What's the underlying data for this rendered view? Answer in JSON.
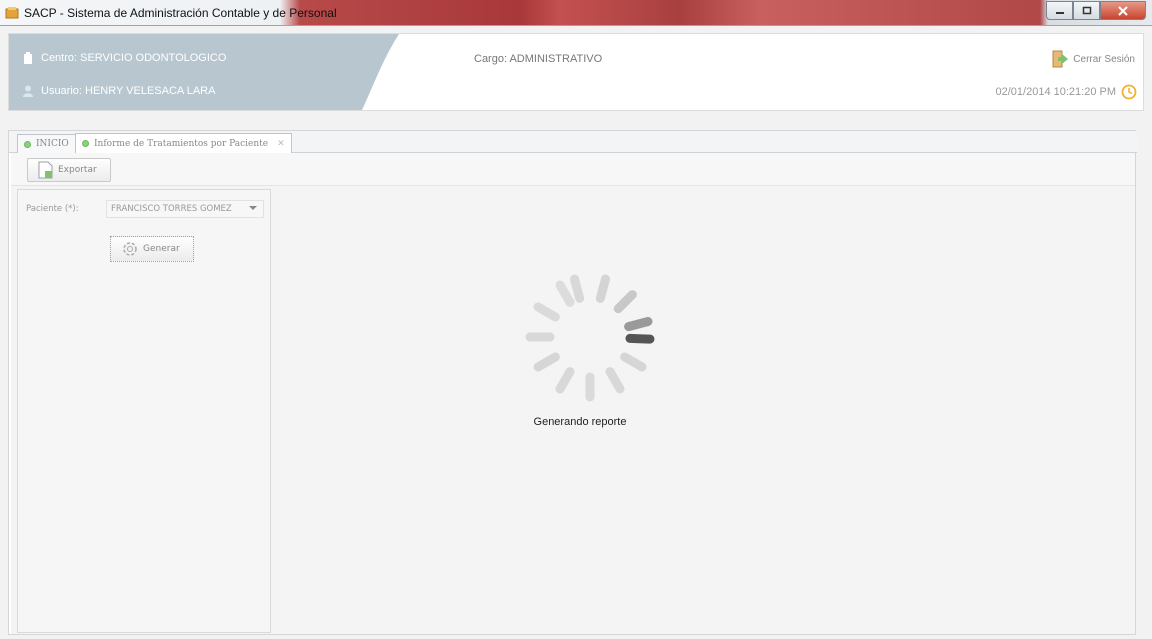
{
  "window": {
    "title": "SACP - Sistema de Administración Contable y de Personal",
    "icon": "app-icon",
    "buttons": [
      "minimize",
      "maximize",
      "close"
    ]
  },
  "header": {
    "centro": "Centro: SERVICIO ODONTOLOGICO",
    "usuario": "Usuario: HENRY VELESACA LARA",
    "cargo": "Cargo:  ADMINISTRATIVO",
    "logout_label": "Cerrar Sesión",
    "datetime": "02/01/2014 10:21:20 PM",
    "accent_color": "#b8c7cf"
  },
  "tabs": [
    {
      "label": "INICIO",
      "active": false
    },
    {
      "label": "Informe de Tratamientos por Paciente",
      "active": true,
      "closable": true
    }
  ],
  "toolbar": {
    "export_label": "Exportar"
  },
  "form": {
    "patient_label": "Paciente (*):",
    "patient_value": "FRANCISCO TORRES GOMEZ",
    "generate_label": "Generar"
  },
  "loading": {
    "text": "Generando reporte"
  }
}
